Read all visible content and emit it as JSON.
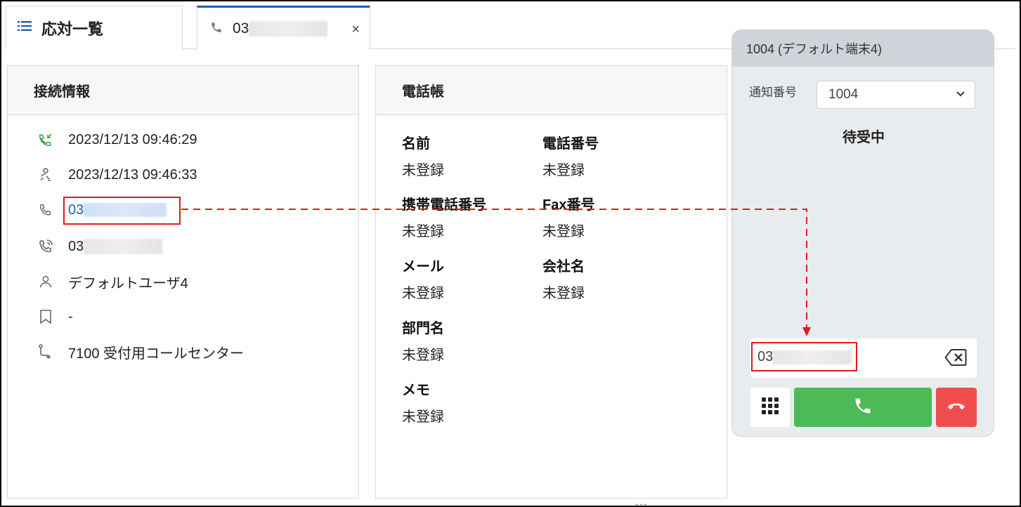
{
  "tabs": {
    "list_label": "応対一覧",
    "call_prefix": "03",
    "close": "×"
  },
  "connection": {
    "title": "接続情報",
    "rows": [
      {
        "icon": "incoming-call-icon",
        "text": "2023/12/13 09:46:29"
      },
      {
        "icon": "user-connect-icon",
        "text": "2023/12/13 09:46:33"
      },
      {
        "icon": "phone-icon",
        "text": "03"
      },
      {
        "icon": "outgoing-call-icon",
        "text": "03"
      },
      {
        "icon": "user-icon",
        "text": "デフォルトユーザ4"
      },
      {
        "icon": "bookmark-icon",
        "text": "-"
      },
      {
        "icon": "route-icon",
        "text": "7100  受付用コールセンター"
      }
    ]
  },
  "phonebook": {
    "title": "電話帳",
    "fields": [
      {
        "label": "名前",
        "value": "未登録"
      },
      {
        "label": "電話番号",
        "value": "未登録"
      },
      {
        "label": "携帯電話番号",
        "value": "未登録"
      },
      {
        "label": "Fax番号",
        "value": "未登録"
      },
      {
        "label": "メール",
        "value": "未登録"
      },
      {
        "label": "会社名",
        "value": "未登録"
      },
      {
        "label": "部門名",
        "value": "未登録"
      },
      {
        "label": "メモ",
        "value": "未登録"
      }
    ]
  },
  "softphone": {
    "header": "1004 (デフォルト端末4)",
    "notify_label": "通知番号",
    "notify_value": "1004",
    "status": "待受中",
    "dial_prefix": "03"
  },
  "colors": {
    "accent": "#1e5fb4",
    "call_green": "#4cbb57",
    "hangup_red": "#f04e4e",
    "highlight_red": "#e21b1b",
    "incoming_green": "#3aa64a"
  }
}
